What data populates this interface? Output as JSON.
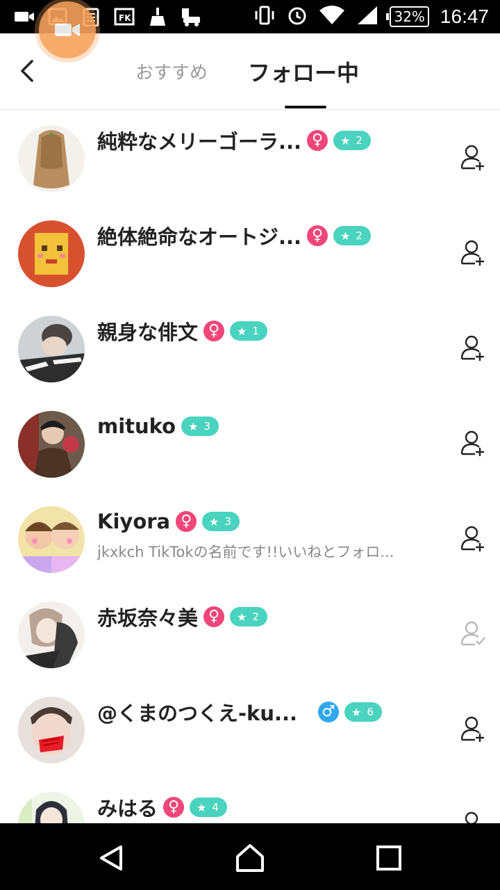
{
  "status_bar": {
    "battery": "32%",
    "time": "16:47"
  },
  "header": {
    "tabs": [
      {
        "label": "おすすめ",
        "active": false
      },
      {
        "label": "フォロー中",
        "active": true
      }
    ]
  },
  "users": [
    {
      "name": "純粋なメリーゴーラ...",
      "gender": "♀",
      "level": "2",
      "bio": "",
      "following": false
    },
    {
      "name": "絶体絶命なオートジ...",
      "gender": "♀",
      "level": "2",
      "bio": "",
      "following": false
    },
    {
      "name": "親身な俳文",
      "gender": "♀",
      "level": "1",
      "bio": "",
      "following": false
    },
    {
      "name": "mituko",
      "gender": "",
      "level": "3",
      "bio": "",
      "following": false
    },
    {
      "name": "Kiyora",
      "gender": "♀",
      "level": "3",
      "bio": "jkxkch TikTokの名前です!!いいねとフォロ...",
      "following": false
    },
    {
      "name": "赤坂奈々美",
      "gender": "♀",
      "level": "2",
      "bio": "",
      "following": true
    },
    {
      "name": "@くまのつくえ-ku...",
      "gender": "♂",
      "level": "6",
      "bio": "",
      "following": false
    },
    {
      "name": "みはる",
      "gender": "♀",
      "level": "4",
      "bio": "",
      "following": false
    }
  ],
  "colors": {
    "female": "#f0467a",
    "male": "#2ea7ee",
    "level_badge": "#4ad3bf",
    "text_primary": "#222222",
    "text_secondary": "#888888"
  }
}
